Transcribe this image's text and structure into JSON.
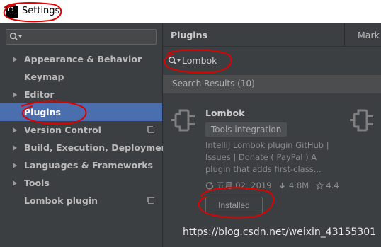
{
  "window": {
    "title": "Settings",
    "logo_text": "IJ"
  },
  "sidebar": {
    "search_value": "",
    "items": [
      {
        "label": "Appearance & Behavior",
        "expandable": true
      },
      {
        "label": "Keymap",
        "expandable": false
      },
      {
        "label": "Editor",
        "expandable": true
      },
      {
        "label": "Plugins",
        "expandable": false
      },
      {
        "label": "Version Control",
        "expandable": true
      },
      {
        "label": "Build, Execution, Deployment",
        "expandable": true
      },
      {
        "label": "Languages & Frameworks",
        "expandable": true
      },
      {
        "label": "Tools",
        "expandable": true
      },
      {
        "label": "Lombok plugin",
        "expandable": false
      }
    ]
  },
  "main": {
    "title": "Plugins",
    "tab_marketplace": "Mark",
    "search_value": "Lombok",
    "results_label": "Search Results (10)",
    "plugin": {
      "name": "Lombok",
      "tag": "Tools integration",
      "description": "IntelliJ Lombok plugin GitHub | Issues | Donate ( PayPal ) A plugin that adds first-class...",
      "date": "五月 02, 2019",
      "downloads": "4.8M",
      "rating": "4.4",
      "button_label": "Installed"
    }
  },
  "watermark": "https://blog.csdn.net/weixin_43155301",
  "colors": {
    "selection": "#4b6eaf",
    "panel": "#3c3f41",
    "annotation": "#e00000"
  }
}
